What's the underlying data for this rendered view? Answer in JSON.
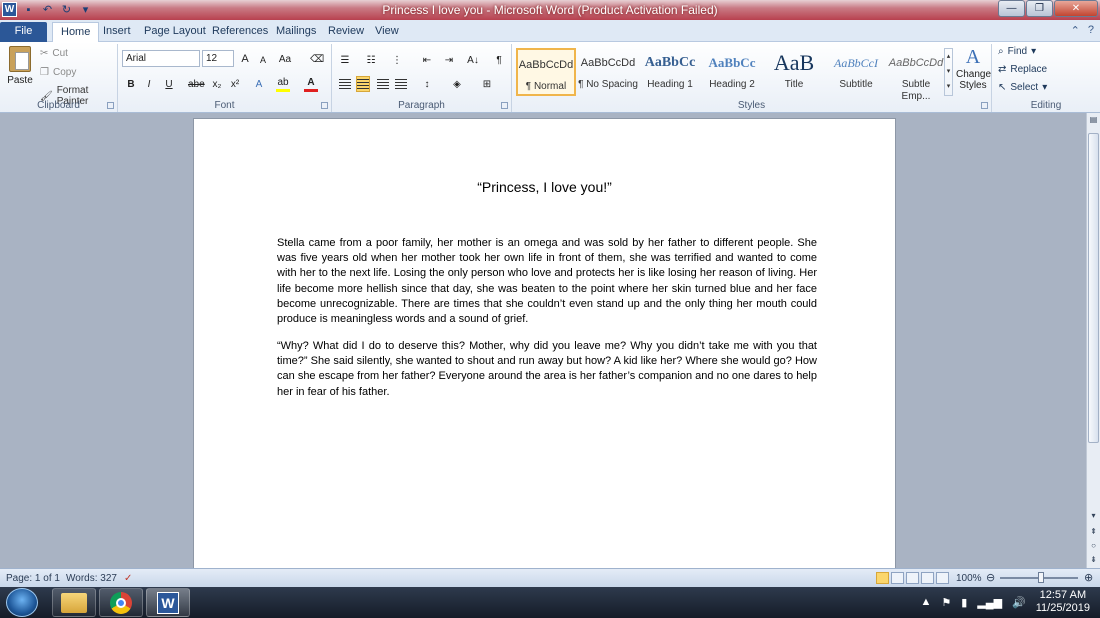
{
  "window": {
    "title": "Princess I love you - Microsoft Word (Product Activation Failed)",
    "app_icon": "W"
  },
  "qat": {
    "save": "save-icon",
    "undo": "undo-icon",
    "redo": "redo-icon"
  },
  "tabs": [
    "File",
    "Home",
    "Insert",
    "Page Layout",
    "References",
    "Mailings",
    "Review",
    "View"
  ],
  "ribbon": {
    "clipboard": {
      "paste": "Paste",
      "cut": "Cut",
      "copy": "Copy",
      "format_painter": "Format Painter",
      "label": "Clipboard"
    },
    "font": {
      "name": "Arial",
      "size": "12",
      "label": "Font",
      "bold": "B",
      "italic": "I",
      "underline": "U",
      "strike": "abe",
      "sub": "x₂",
      "sup": "x²",
      "grow": "A",
      "shrink": "A",
      "case": "Aa"
    },
    "paragraph": {
      "label": "Paragraph",
      "sort": "A↓",
      "pilcrow": "¶"
    },
    "styles": {
      "label": "Styles",
      "items": [
        {
          "preview": "AaBbCcDd",
          "label": "¶ Normal"
        },
        {
          "preview": "AaBbCcDd",
          "label": "¶ No Spacing"
        },
        {
          "preview": "AaBbCc",
          "label": "Heading 1"
        },
        {
          "preview": "AaBbCc",
          "label": "Heading 2"
        },
        {
          "preview": "AaB",
          "label": "Title"
        },
        {
          "preview": "AaBbCcI",
          "label": "Subtitle"
        },
        {
          "preview": "AaBbCcDd",
          "label": "Subtle Emp..."
        }
      ],
      "change_styles": "Change Styles"
    },
    "editing": {
      "label": "Editing",
      "find": "Find",
      "replace": "Replace",
      "select": "Select"
    }
  },
  "document": {
    "title": "“Princess, I love you!”",
    "paragraphs": [
      "Stella came from a poor family, her mother is an omega and was sold by her father to different people. She was five years old when her mother took her own life in front of them, she was terrified and wanted to come with her to the next life. Losing the only person who love and protects her is like losing her reason of living. Her life become more hellish since that day, she was beaten to the point where her skin turned blue and her face become unrecognizable. There are times that she couldn’t even stand up and the only thing her mouth could produce is meaningless words and a sound of grief.",
      "“Why? What did I do to deserve this? Mother, why did you leave me? Why you didn’t take me with you that time?” She said silently, she wanted to shout and run away but how? A kid like her? Where she would go? How can she escape from her father? Everyone around the area is her father’s companion and no one dares to help her in fear of his father."
    ]
  },
  "status": {
    "page": "Page: 1 of 1",
    "words": "Words: 327",
    "zoom": "100%"
  },
  "taskbar": {
    "time": "12:57 AM",
    "date": "11/25/2019"
  }
}
